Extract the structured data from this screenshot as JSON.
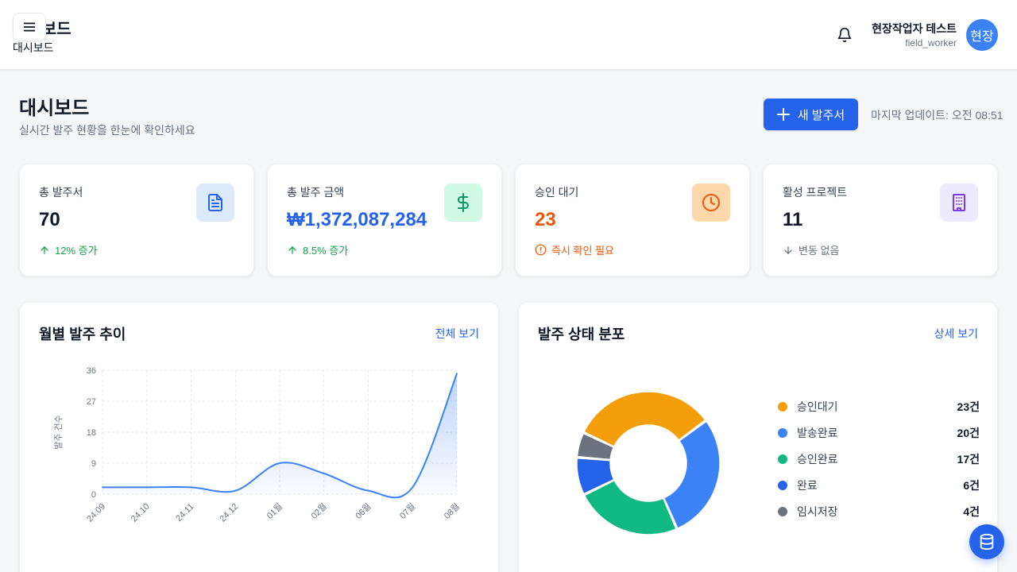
{
  "header": {
    "title": "대시보드",
    "subtitle": "대시보드",
    "user_name": "현장작업자 테스트",
    "user_role": "field_worker",
    "avatar_text": "현장"
  },
  "page": {
    "title": "대시보드",
    "subtitle": "실시간 발주 현황을 한눈에 확인하세요",
    "new_order_label": "새 발주서",
    "last_update": "마지막 업데이트: 오전 08:51"
  },
  "stats": [
    {
      "label": "총 발주서",
      "value": "70",
      "trend": "12% 증가",
      "trend_icon": "arrow-up-icon",
      "value_color": "#111827",
      "trend_color": "#16a34a",
      "icon": "document-icon",
      "icon_bg": "#dbeafe",
      "icon_color": "#2563eb"
    },
    {
      "label": "총 발주 금액",
      "value": "₩1,372,087,284",
      "trend": "8.5% 증가",
      "trend_icon": "arrow-up-icon",
      "value_color": "#2563eb",
      "trend_color": "#16a34a",
      "icon": "dollar-icon",
      "icon_bg": "#d1fae5",
      "icon_color": "#059669"
    },
    {
      "label": "승인 대기",
      "value": "23",
      "trend": "즉시 확인 필요",
      "trend_icon": "alert-circle-icon",
      "value_color": "#ea580c",
      "trend_color": "#ea580c",
      "icon": "clock-icon",
      "icon_bg": "#fed7aa",
      "icon_color": "#ea580c"
    },
    {
      "label": "활성 프로젝트",
      "value": "11",
      "trend": "변동 없음",
      "trend_icon": "arrow-down-icon",
      "value_color": "#111827",
      "trend_color": "#6b7280",
      "icon": "building-icon",
      "icon_bg": "#ede9fe",
      "icon_color": "#7c3aed"
    }
  ],
  "monthly": {
    "title": "월별 발주 추이",
    "link": "전체 보기"
  },
  "status": {
    "title": "발주 상태 분포",
    "link": "상세 보기"
  },
  "chart_data": [
    {
      "type": "line",
      "ylabel": "발주 건수",
      "x": [
        "24.09",
        "24.10",
        "24.11",
        "24.12",
        "01월",
        "02월",
        "06월",
        "07월",
        "08월"
      ],
      "values": [
        2,
        2,
        2,
        1,
        9,
        6,
        1,
        2,
        35
      ],
      "ylim": [
        0,
        36
      ],
      "yticks": [
        0,
        9,
        18,
        27,
        36
      ],
      "grid": true,
      "color": "#3b82f6"
    },
    {
      "type": "pie",
      "donut": true,
      "legend_position": "right",
      "slices": [
        {
          "label": "승인대기",
          "value": 23,
          "count_label": "23건",
          "color": "#f59e0b"
        },
        {
          "label": "발송완료",
          "value": 20,
          "count_label": "20건",
          "color": "#3b82f6"
        },
        {
          "label": "승인완료",
          "value": 17,
          "count_label": "17건",
          "color": "#10b981"
        },
        {
          "label": "완료",
          "value": 6,
          "count_label": "6건",
          "color": "#2563eb"
        },
        {
          "label": "임시저장",
          "value": 4,
          "count_label": "4건",
          "color": "#6b7280"
        }
      ]
    }
  ]
}
